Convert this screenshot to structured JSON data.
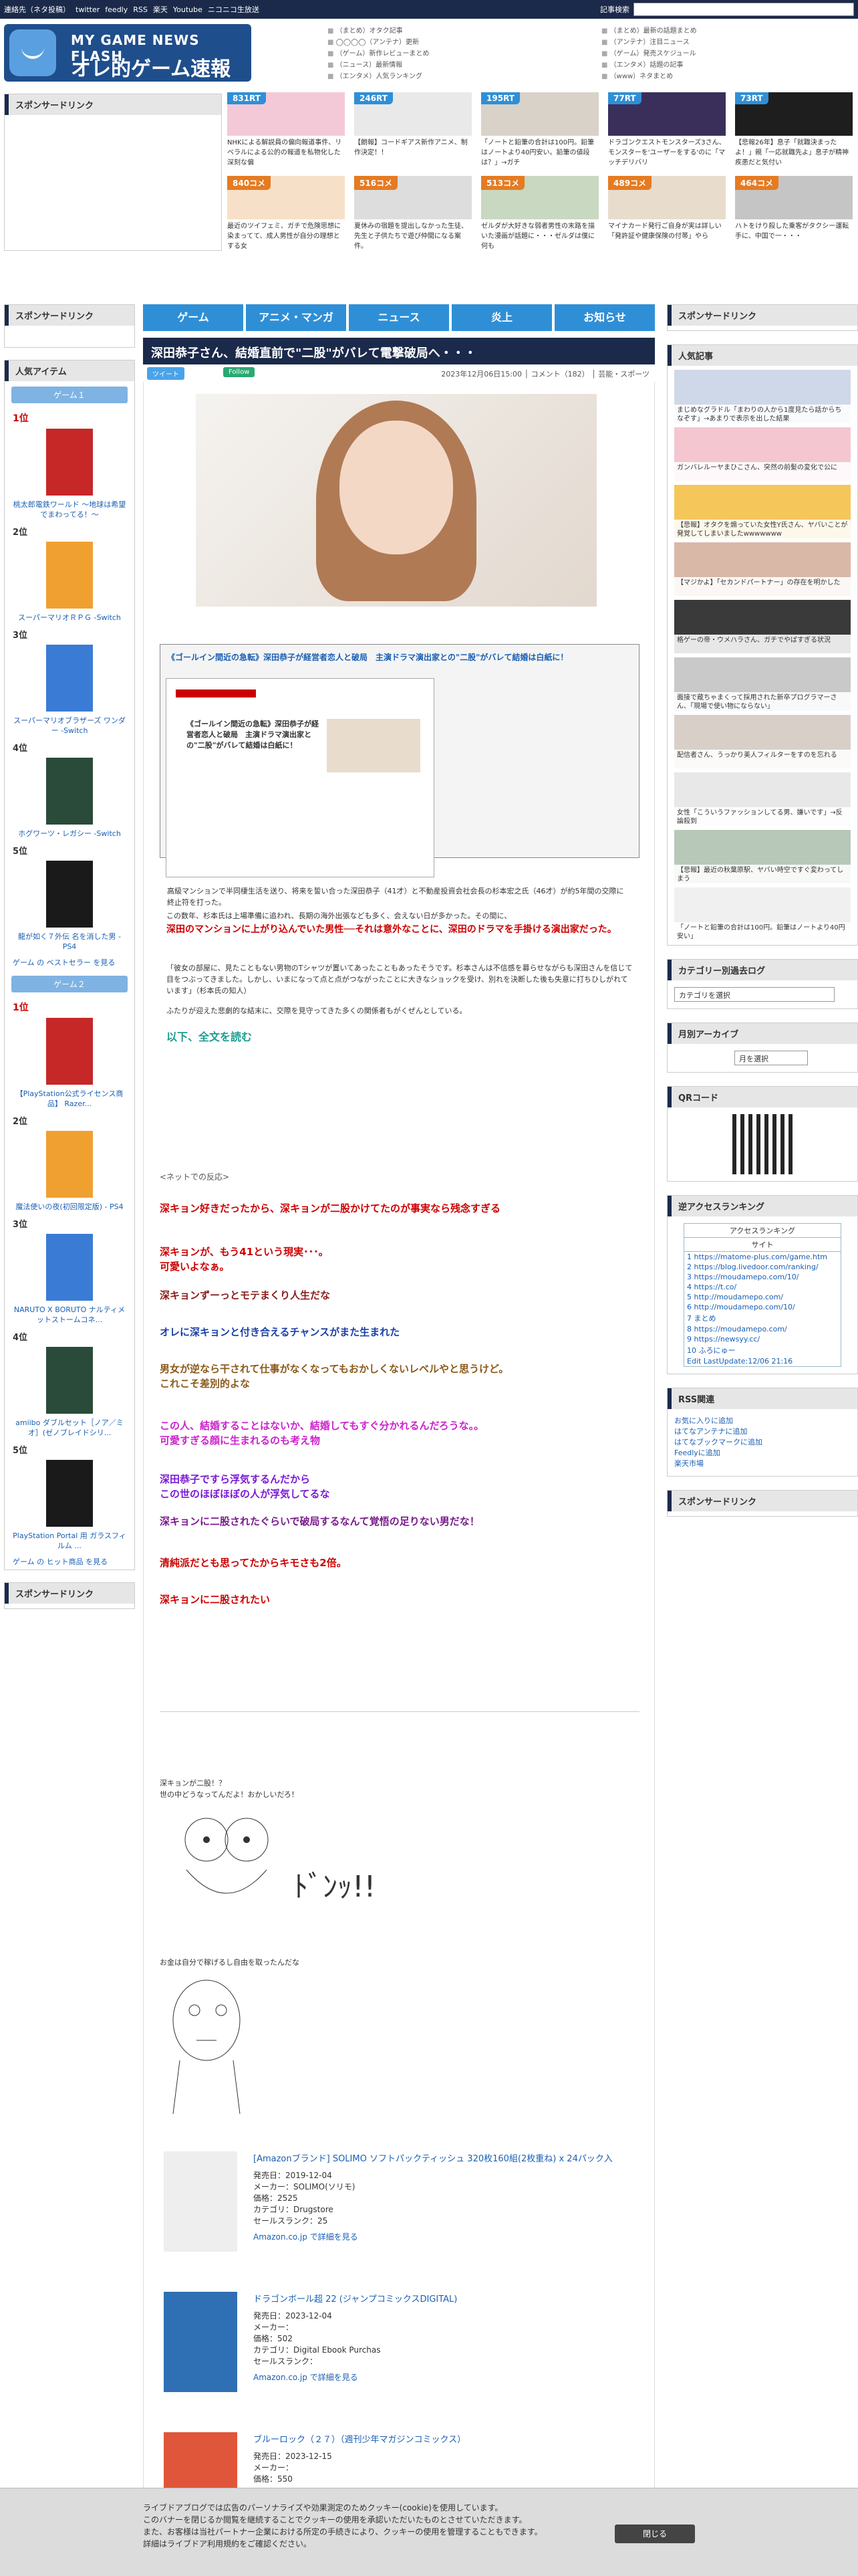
{
  "topbar": {
    "links": [
      "連絡先（ネタ投稿）",
      "twitter",
      "feedly",
      "RSS",
      "楽天",
      "Youtube",
      "ニコニコ生放送"
    ],
    "search_label": "記事検索"
  },
  "logo": {
    "small": "MY GAME NEWS FLASH",
    "big": "オレ的ゲーム速報@JIN"
  },
  "hdrlist1": [
    "（まとめ）オタク記事",
    "◯◯◯◯（アンテナ）更新",
    "（ゲーム）新作レビューまとめ",
    "（ニュース）最新情報",
    "（エンタメ）人気ランキング"
  ],
  "hdrlist2": [
    "（まとめ）最新の話題まとめ",
    "（アンテナ）注目ニュース",
    "（ゲーム）発売スケジュール",
    "（エンタメ）話題の記事",
    "（www）ネタまとめ"
  ],
  "sponsor_top": "スポンサードリンク",
  "thumbs": [
    {
      "badge": "831RT",
      "color": "#2f8fd6",
      "cap": "NHKによる解説員の偏向報道事件、リベラルによる公的の報道を私物化した深刻な偏"
    },
    {
      "badge": "246RT",
      "color": "#2f8fd6",
      "cap": "【朗報】コードギアス新作アニメ、制作決定！！"
    },
    {
      "badge": "195RT",
      "color": "#2f8fd6",
      "cap": "「ノートと鉛筆の合計は100円。鉛筆はノートより40円安い。鉛筆の値段は？」→ガチ"
    },
    {
      "badge": "77RT",
      "color": "#2f8fd6",
      "cap": "ドラゴンクエストモンスターズ3さん、モンスターを'ユーザーをする'のに「マッチデリバリ"
    },
    {
      "badge": "73RT",
      "color": "#2f8fd6",
      "cap": "【悲報26年】息子「就職決まったよ！」親「一応就職先よ」息子が精神疾患だと気付い"
    },
    {
      "badge": "840コメ",
      "color": "#e57b22",
      "cap": "最近のツイフェミ、ガチで危険思想に染まってて、成人男性が自分の理想とする女"
    },
    {
      "badge": "516コメ",
      "color": "#e57b22",
      "cap": "夏休みの宿題を提出しなかった生徒、先生と子供たちで遊び仲間になる案件。"
    },
    {
      "badge": "513コメ",
      "color": "#e57b22",
      "cap": "ゼルダが大好きな弱者男性の末路を描いた漫画が話題に・・・ゼルダは僕に何も"
    },
    {
      "badge": "489コメ",
      "color": "#e57b22",
      "cap": "マイナカード発行ご自身が実は詳しい「発許証や健康保険の付帯」やら"
    },
    {
      "badge": "464コメ",
      "color": "#e57b22",
      "cap": "ハトをけり殺した乗客がタクシー運転手に、中国で一・・・"
    }
  ],
  "left": {
    "sponsor": "スポンサードリンク",
    "popular": "人気アイテム",
    "cat1": "ゲーム１",
    "cat2": "ゲーム２",
    "sponsor2": "スポンサードリンク",
    "ranks1": [
      {
        "no": "1位",
        "name": "桃太郎電鉄ワールド ～地球は希望でまわってる！～"
      },
      {
        "no": "2位",
        "name": "スーパーマリオＲＰＧ -Switch"
      },
      {
        "no": "3位",
        "name": "スーパーマリオブラザーズ ワンダー -Switch"
      },
      {
        "no": "4位",
        "name": "ホグワーツ・レガシー -Switch"
      },
      {
        "no": "5位",
        "name": "龍が如く７外伝 名を消した男 - PS4"
      }
    ],
    "more1": "ゲーム の ベストセラー を見る",
    "ranks2": [
      {
        "no": "1位",
        "name": "【PlayStation公式ライセンス商品】 Razer..."
      },
      {
        "no": "2位",
        "name": "魔法使いの夜(初回限定版) - PS4"
      },
      {
        "no": "3位",
        "name": "NARUTO X BORUTO ナルティメットストームコネ..."
      },
      {
        "no": "4位",
        "name": "amiibo ダブルセット［ノア／ミオ］(ゼノブレイドシリ..."
      },
      {
        "no": "5位",
        "name": "PlayStation Portal 用 ガラスフィルム ..."
      }
    ],
    "more2": "ゲーム の ヒット商品 を見る"
  },
  "nav": [
    "ゲーム",
    "アニメ・マンガ",
    "ニュース",
    "炎上",
    "お知らせ"
  ],
  "article": {
    "title": "深田恭子さん、結婚直前で\"二股\"がバレて電撃破局へ・・・",
    "tweet": "ツイート",
    "follow": "Follow",
    "date": "2023年12月06日15:00 │ コメント（182） │ 芸能・スポーツ",
    "quote_head": "《ゴールイン間近の急転》深田恭子が経営者恋人と破局　主演ドラマ演出家との\"二股\"がバレて結婚は白紙に！",
    "shot_title": "《ゴールイン間近の急転》深田恭子が経営者恋人と破局　主演ドラマ演出家との\"二股\"がバレて結婚は白紙に！",
    "p1": "高級マンションで半同棲生活を送り、将来を誓い合った深田恭子（41才）と不動産投資会社会長の杉本宏之氏（46才）が約5年間の交際に終止符を打った。",
    "p2": "この数年、杉本氏は上場準備に追われ、長期の海外出張なども多く、会えない日が多かった。その間に、",
    "p3": "深田のマンションに上がり込んでいた男性──それは意外なことに、深田のドラマを手掛ける演出家だった。",
    "p4": "「彼女の部屋に、見たこともない男物のTシャツが置いてあったこともあったそうです。杉本さんは不信感を募らせながらも深田さんを信じて目をつぶってきました。しかし、いまになって点と点がつながったことに大きなショックを受け、別れを決断した後も失意に打ちひしがれています」（杉本氏の知人）",
    "p5": "ふたりが迎えた悲劇的な結末に、交際を見守ってきた多くの関係者もがくぜんとしている。",
    "more": "以下、全文を読む",
    "net": "<ネットでの反応>",
    "comments": [
      {
        "t": "深キョン好きだったから、深キョンが二股かけてたのが事実なら残念すぎる",
        "c": "#c00"
      },
      {
        "t": "深キョンが、もう41という現実･･･。\n可愛いよなぁ。",
        "c": "#c00"
      },
      {
        "t": "深キョンずーっとモテまくり人生だな",
        "c": "#8b1a1a"
      },
      {
        "t": "オレに深キョンと付き合えるチャンスがまた生まれた",
        "c": "#1a3fa8"
      },
      {
        "t": "男女が逆なら干されて仕事がなくなってもおかしくないレベルやと思うけど。\nこれこそ差別的よな",
        "c": "#8b5a1a"
      },
      {
        "t": "この人、結婚することはないか、結婚してもすぐ分かれるんだろうな。。\n可愛すぎる顔に生まれるのも考え物",
        "c": "#cc22cc"
      },
      {
        "t": "深田恭子ですら浮気するんだから\nこの世のほぼほぼの人が浮気してるな",
        "c": "#7a1ad6"
      },
      {
        "t": "深キョンに二股されたぐらいで破局するなんて覚悟の足りない男だな！",
        "c": "#7a1a8c"
      },
      {
        "t": "清純派だとも思ってたからキモさも2倍。",
        "c": "#c00"
      },
      {
        "t": "深キョンに二股されたい",
        "c": "#c00"
      }
    ],
    "aa1_text": "深キョンが二股！？\n世の中どうなってんだよ！おかしいだろ！",
    "aa2_text": "お金は自分で稼げるし自由を取ったんだな"
  },
  "products": [
    {
      "title": "[Amazonブランド] SOLIMO ソフトパックティッシュ 320枚160組(2枚重ね) x 24パック入",
      "info": "発売日：2019-12-04\nメーカー：SOLIMO(ソリモ)\n価格：2525\nカテゴリ：Drugstore\nセールスランク：25",
      "link": "Amazon.co.jp で詳細を見る"
    },
    {
      "title": "ドラゴンボール超 22 (ジャンプコミックスDIGITAL)",
      "info": "発売日：2023-12-04\nメーカー：\n価格：502\nカテゴリ：Digital Ebook Purchas\nセールスランク：",
      "link": "Amazon.co.jp で詳細を見る"
    },
    {
      "title": "ブルーロック（２７）（週刊少年マガジンコミックス）",
      "info": "発売日：2023-12-15\nメーカー：\n価格：550",
      "link": ""
    }
  ],
  "right": {
    "sponsor": "スポンサードリンク",
    "popular": "人気記事",
    "pop": [
      "まじめなグラドル「まわりの人から1度見たら話からちなぞす」→あまりで表示を出した結果",
      "ガンバレルーヤまひこさん、突然の前髪の変化で公に",
      "【悲報】オタクを煽っていた女性Y氏さん、ヤバいことが発覚してしまいましたwwwwwww",
      "【マジかよ】「セカンドパートナー」の存在を明かした",
      "格ゲーの帝・ウメハラさん、ガチでやばすぎる状況",
      "面接で蔵ちゃまくって採用された新卒プログラマーさん、「現場で使い物にならない」",
      "配信者さん、うっかり美人フィルターをすのを忘れる",
      "女性「こういうファッションしてる男、嫌いです」→反論殺到",
      "【悲報】最近の秋葉原駅、ヤバい時空ですぐ変わってしまう",
      "「ノートと鉛筆の合計は100円。鉛筆はノートより40円安い」"
    ],
    "catlog": "カテゴリー別過去ログ",
    "catsel": "カテゴリを選択",
    "monthly": "月別アーカイブ",
    "monthsel": "月を選択",
    "qr": "QRコード",
    "rev": "逆アクセスランキング",
    "acc_head": "アクセスランキング",
    "acc_site": "サイト",
    "acc": [
      "1 https://matome-plus.com/game.htm",
      "2 https://blog.livedoor.com/ranking/",
      "3 https://moudamepo.com/10/",
      "4 https://t.co/",
      "5 http://moudamepo.com/",
      "6 http://moudamepo.com/10/",
      "7 まとめ",
      "8 https://moudamepo.com/",
      "9 https://newsyy.cc/",
      "10 ふろにゅー"
    ],
    "acc_update": "Edit LastUpdate:12/06 21:16",
    "rss": "RSS関連",
    "rsslinks": [
      "お気に入りに追加",
      "はてなアンテナに追加",
      "はてなブックマークに追加",
      "Feedlyに追加",
      "楽天市場"
    ],
    "sponsor2": "スポンサードリンク"
  },
  "cookie": {
    "txt": "ライブドアブログでは広告のパーソナライズや効果測定のためクッキー(cookie)を使用しています。\nこのバナーを閉じるか閲覧を継続することでクッキーの使用を承認いただいたものとさせていただきます。\nまた、お客様は当社パートナー企業における所定の手続きにより、クッキーの使用を管理することもできます。\n詳細はライブドア利用規約をご確認ください。",
    "btn": "閉じる"
  }
}
